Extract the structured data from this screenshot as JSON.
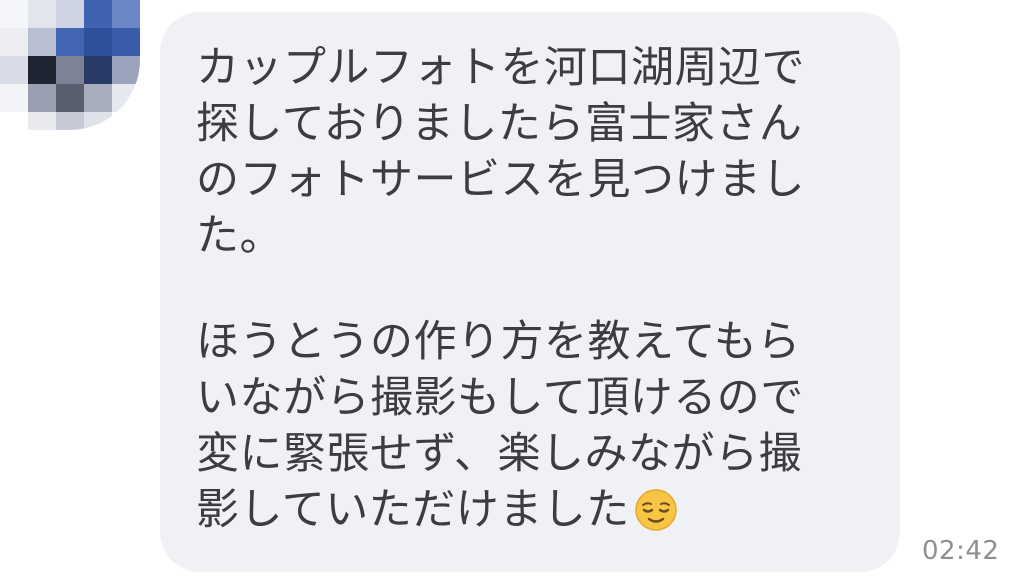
{
  "avatar": {
    "icon": "blurred-profile-photo",
    "palette": [
      "#ffffff",
      "#e9ebf2",
      "#3b5ea8",
      "#2f4f98",
      "#cfd3de",
      "#8b91a6",
      "#1d2230",
      "#5b5f70",
      "#a6abbb"
    ]
  },
  "message": {
    "paragraphs": [
      [
        "カップルフォトを河口湖周辺で",
        "探しておりましたら富士家さん",
        "のフォトサービスを見つけまし",
        "た。"
      ],
      [
        "ほうとうの作り方を教えてもら",
        "いながら撮影もして頂けるので",
        "変に緊張せず、楽しみながら撮",
        "影していただけました"
      ]
    ],
    "emoji": "relieved-face-icon",
    "bubble_color": "#f0f1f4",
    "text_color": "#3c3d40"
  },
  "timestamp": "02:42"
}
